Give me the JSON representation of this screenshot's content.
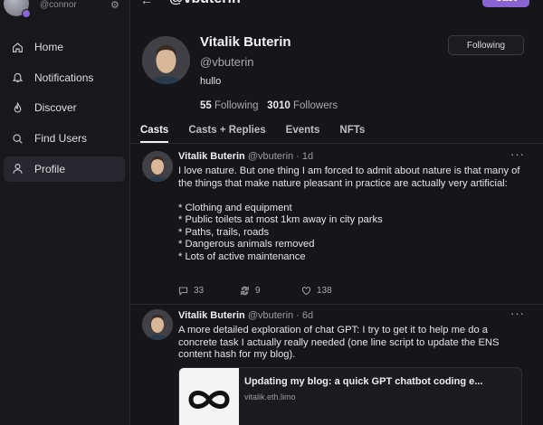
{
  "account": {
    "handle": "@connor"
  },
  "nav": [
    {
      "label": "Home",
      "icon": "home-icon"
    },
    {
      "label": "Notifications",
      "icon": "bell-icon"
    },
    {
      "label": "Discover",
      "icon": "flame-icon"
    },
    {
      "label": "Find Users",
      "icon": "search-icon"
    },
    {
      "label": "Profile",
      "icon": "user-icon",
      "active": true
    }
  ],
  "header": {
    "title": "@vbuterin",
    "cast_label": "Cast"
  },
  "profile": {
    "name": "Vitalik Buterin",
    "handle": "@vbuterin",
    "bio": "hullo",
    "following_count": "55",
    "following_label": "Following",
    "followers_count": "3010",
    "followers_label": "Followers",
    "follow_button": "Following"
  },
  "tabs": [
    "Casts",
    "Casts + Replies",
    "Events",
    "NFTs"
  ],
  "casts": [
    {
      "name": "Vitalik Buterin",
      "meta": "@vbuterin · 1d",
      "text": "I love nature. But one thing I am forced to admit about nature is that many of the things that make nature pleasant in practice are actually very artificial:\n\n* Clothing and equipment\n* Public toilets at most 1km away in city parks\n* Paths, trails, roads\n* Dangerous animals removed\n* Lots of active maintenance",
      "replies": "33",
      "recasts": "9",
      "likes": "138"
    },
    {
      "name": "Vitalik Buterin",
      "meta": "@vbuterin · 6d",
      "text": "A more detailed exploration of chat GPT: I try to get it to help me do a concrete task I actually really needed (one line script to update the ENS content hash for my blog).",
      "embed_title": "Updating my blog: a quick GPT chatbot coding e...",
      "embed_domain": "vitalik.eth.limo"
    }
  ],
  "colors": {
    "accent": "#8a63d2",
    "background": "#16161a"
  }
}
